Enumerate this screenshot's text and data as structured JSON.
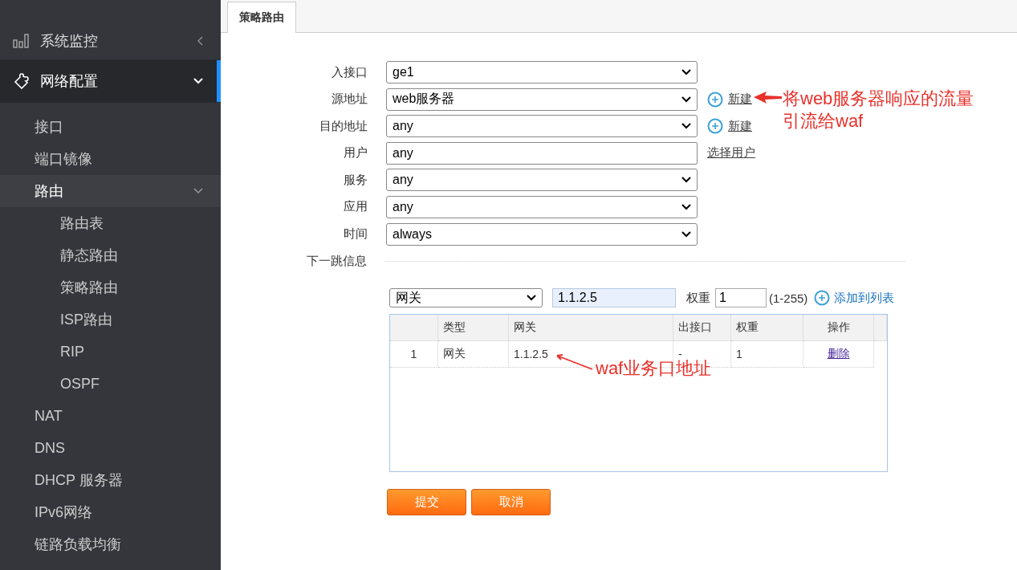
{
  "sidebar": {
    "items": [
      {
        "label": "系统监控",
        "expanded": false,
        "selected": false
      },
      {
        "label": "网络配置",
        "expanded": true,
        "selected": true,
        "children": [
          {
            "label": "接口",
            "selected": false
          },
          {
            "label": "端口镜像",
            "selected": false
          },
          {
            "label": "路由",
            "selected": true,
            "expanded": true,
            "children": [
              {
                "label": "路由表"
              },
              {
                "label": "静态路由"
              },
              {
                "label": "策略路由"
              },
              {
                "label": "ISP路由"
              },
              {
                "label": "RIP"
              },
              {
                "label": "OSPF"
              }
            ]
          },
          {
            "label": "NAT",
            "selected": false
          },
          {
            "label": "DNS",
            "selected": false
          },
          {
            "label": "DHCP 服务器",
            "selected": false
          },
          {
            "label": "IPv6网络",
            "selected": false
          },
          {
            "label": "链路负载均衡",
            "selected": false
          }
        ]
      }
    ]
  },
  "tabs": [
    {
      "label": "策略路由",
      "selected": true
    }
  ],
  "form": {
    "fields": [
      {
        "label": "入接口",
        "kind": "select",
        "value": "ge1"
      },
      {
        "label": "源地址",
        "kind": "select",
        "value": "web服务器",
        "link": "新建"
      },
      {
        "label": "目的地址",
        "kind": "select",
        "value": "any",
        "link": "新建"
      },
      {
        "label": "用户",
        "kind": "input",
        "value": "any",
        "link": "选择用户"
      },
      {
        "label": "服务",
        "kind": "select",
        "value": "any"
      },
      {
        "label": "应用",
        "kind": "select",
        "value": "any"
      },
      {
        "label": "时间",
        "kind": "select",
        "value": "always"
      }
    ]
  },
  "next_hop": {
    "section_label": "下一跳信息",
    "type_value": "网关",
    "gateway_value": "1.1.2.5",
    "weight_label": "权重",
    "weight_value": "1",
    "weight_range": "(1-255)",
    "add_link": "添加到列表"
  },
  "table": {
    "columns": [
      "",
      "类型",
      "网关",
      "出接口",
      "权重",
      "操作"
    ],
    "rows": [
      {
        "cells": [
          "1",
          "网关",
          "1.1.2.5",
          "-",
          "1"
        ],
        "action": "删除"
      }
    ]
  },
  "buttons": [
    "提交",
    "取消"
  ],
  "annotations": [
    {
      "text": "将web服务器响应的流量引流给waf"
    },
    {
      "text": "waf业务口地址"
    }
  ]
}
